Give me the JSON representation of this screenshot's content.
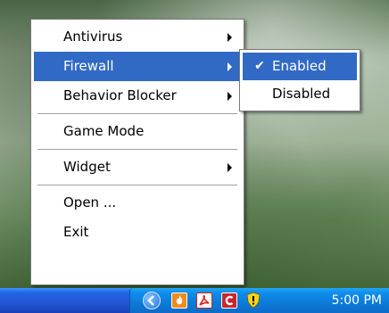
{
  "main_menu": {
    "items": [
      {
        "label": "Antivirus",
        "submenu": true
      },
      {
        "label": "Firewall",
        "submenu": true
      },
      {
        "label": "Behavior Blocker",
        "submenu": true
      },
      {
        "label": "Game Mode",
        "submenu": false
      },
      {
        "label": "Widget",
        "submenu": true
      },
      {
        "label": "Open ...",
        "submenu": false
      },
      {
        "label": "Exit",
        "submenu": false
      }
    ]
  },
  "firewall_submenu": {
    "items": [
      {
        "label": "Enabled",
        "checked": true
      },
      {
        "label": "Disabled",
        "checked": false
      }
    ]
  },
  "taskbar": {
    "tray_icons": [
      "show-hidden-icons-icon",
      "flame-app-icon",
      "pdf-app-icon",
      "red-c-app-icon",
      "security-shield-icon"
    ],
    "clock": "5:00 PM"
  },
  "colors": {
    "highlight": "#316ac5",
    "taskbar": "#2457d6",
    "tray": "#0f8ded"
  }
}
